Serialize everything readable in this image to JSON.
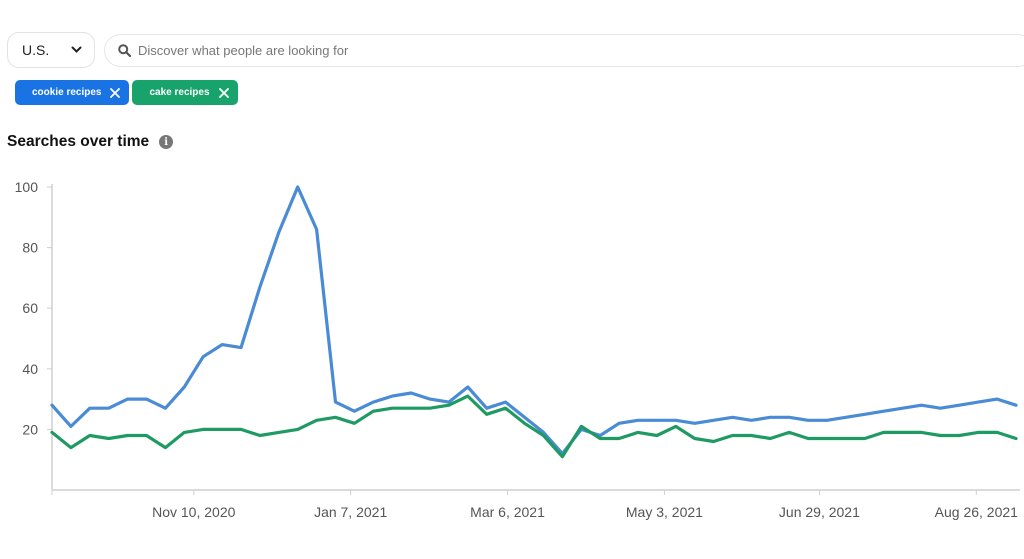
{
  "filters": {
    "country": {
      "selected": "U.S.",
      "icon": "chevron-down-icon"
    },
    "search": {
      "placeholder": "Discover what people are looking for",
      "value": "",
      "icon": "search-icon"
    },
    "tags": [
      {
        "label": "cookie recipes",
        "color": "#1a73e3",
        "remove_icon": "close-icon"
      },
      {
        "label": "cake recipes",
        "color": "#17a36b",
        "remove_icon": "close-icon"
      }
    ]
  },
  "section": {
    "title": "Searches over time",
    "info_icon": "info-icon"
  },
  "chart_data": {
    "type": "line",
    "title": "Searches over time",
    "xlabel": "",
    "ylabel": "",
    "ylim": [
      0,
      100
    ],
    "yticks": [
      20,
      40,
      60,
      80,
      100
    ],
    "xtick_labels": [
      "Nov 10, 2020",
      "Jan 7, 2021",
      "Mar 6, 2021",
      "May 3, 2021",
      "Jun 29, 2021",
      "Aug 26, 2021"
    ],
    "xtick_indices": [
      7.5,
      15.8,
      24.1,
      32.4,
      40.6,
      48.9
    ],
    "grid": false,
    "legend": "tags above chart",
    "series": [
      {
        "name": "cookie recipes",
        "color": "#4a8bd6",
        "values": [
          28,
          21,
          27,
          27,
          30,
          30,
          27,
          34,
          44,
          48,
          47,
          67,
          85,
          100,
          86,
          29,
          26,
          29,
          31,
          32,
          30,
          29,
          34,
          27,
          29,
          24,
          19,
          12,
          20,
          18,
          22,
          23,
          23,
          23,
          22,
          23,
          24,
          23,
          24,
          24,
          23,
          23,
          24,
          25,
          26,
          27,
          28,
          27,
          28,
          29,
          30,
          28
        ]
      },
      {
        "name": "cake recipes",
        "color": "#1f9a63",
        "values": [
          19,
          14,
          18,
          17,
          18,
          18,
          14,
          19,
          20,
          20,
          20,
          18,
          19,
          20,
          23,
          24,
          22,
          26,
          27,
          27,
          27,
          28,
          31,
          25,
          27,
          22,
          18,
          11,
          21,
          17,
          17,
          19,
          18,
          21,
          17,
          16,
          18,
          18,
          17,
          19,
          17,
          17,
          17,
          17,
          19,
          19,
          19,
          18,
          18,
          19,
          19,
          17
        ]
      }
    ]
  }
}
